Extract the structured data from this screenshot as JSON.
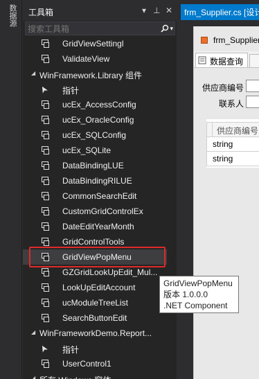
{
  "side_tab": {
    "label": "数据源"
  },
  "toolbox": {
    "title": "工具箱",
    "title_icons": {
      "dropdown": "▾",
      "pin": "⊥",
      "close": "✕"
    },
    "search": {
      "placeholder": "搜索工具箱",
      "icon": "search-icon",
      "dropdown_icon": "▾"
    },
    "items": [
      {
        "kind": "item",
        "icon": "control-icon",
        "label": "GridViewSettingl"
      },
      {
        "kind": "item",
        "icon": "control-icon",
        "label": "ValidateView"
      },
      {
        "kind": "group",
        "label": "WinFramework.Library 组件"
      },
      {
        "kind": "item",
        "icon": "pointer-icon",
        "label": "指针"
      },
      {
        "kind": "item",
        "icon": "control-icon",
        "label": "ucEx_AccessConfig"
      },
      {
        "kind": "item",
        "icon": "control-icon",
        "label": "ucEx_OracleConfig"
      },
      {
        "kind": "item",
        "icon": "control-icon",
        "label": "ucEx_SQLConfig"
      },
      {
        "kind": "item",
        "icon": "control-icon",
        "label": "ucEx_SQLite"
      },
      {
        "kind": "item",
        "icon": "control-icon",
        "label": "DataBindingLUE"
      },
      {
        "kind": "item",
        "icon": "control-icon",
        "label": "DataBindingRILUE"
      },
      {
        "kind": "item",
        "icon": "control-icon",
        "label": "CommonSearchEdit"
      },
      {
        "kind": "item",
        "icon": "control-icon",
        "label": "CustomGridControlEx"
      },
      {
        "kind": "item",
        "icon": "control-icon",
        "label": "DateEditYearMonth"
      },
      {
        "kind": "item",
        "icon": "control-icon",
        "label": "GridControlTools"
      },
      {
        "kind": "item",
        "icon": "control-icon",
        "label": "GridViewPopMenu",
        "hovered": true
      },
      {
        "kind": "item",
        "icon": "control-icon",
        "label": "GZGridLookUpEdit_Mul..."
      },
      {
        "kind": "item",
        "icon": "control-icon",
        "label": "LookUpEditAccount"
      },
      {
        "kind": "item",
        "icon": "control-icon",
        "label": "ucModuleTreeList"
      },
      {
        "kind": "item",
        "icon": "control-icon",
        "label": "SearchButtonEdit"
      },
      {
        "kind": "group",
        "label": "WinFrameworkDemo.Report..."
      },
      {
        "kind": "item",
        "icon": "pointer-icon",
        "label": "指针"
      },
      {
        "kind": "item",
        "icon": "control-icon",
        "label": "UserControl1"
      },
      {
        "kind": "group",
        "label": "所有 Windows 窗体"
      }
    ]
  },
  "document": {
    "tab_label": "frm_Supplier.cs [设计]",
    "form_title": "frm_Supplier",
    "inner_tab_label": "数据查询",
    "fields": [
      {
        "label": "供应商编号"
      },
      {
        "label": "联系人"
      }
    ],
    "grid": {
      "header": "供应商编号",
      "rows": [
        "string",
        "string"
      ]
    }
  },
  "tooltip": {
    "name": "GridViewPopMenu",
    "version": "版本 1.0.0.0",
    "kind": ".NET Component"
  },
  "colors": {
    "accent": "#007acc",
    "highlight_box": "#e02a2a",
    "panel_bg": "#252526"
  }
}
